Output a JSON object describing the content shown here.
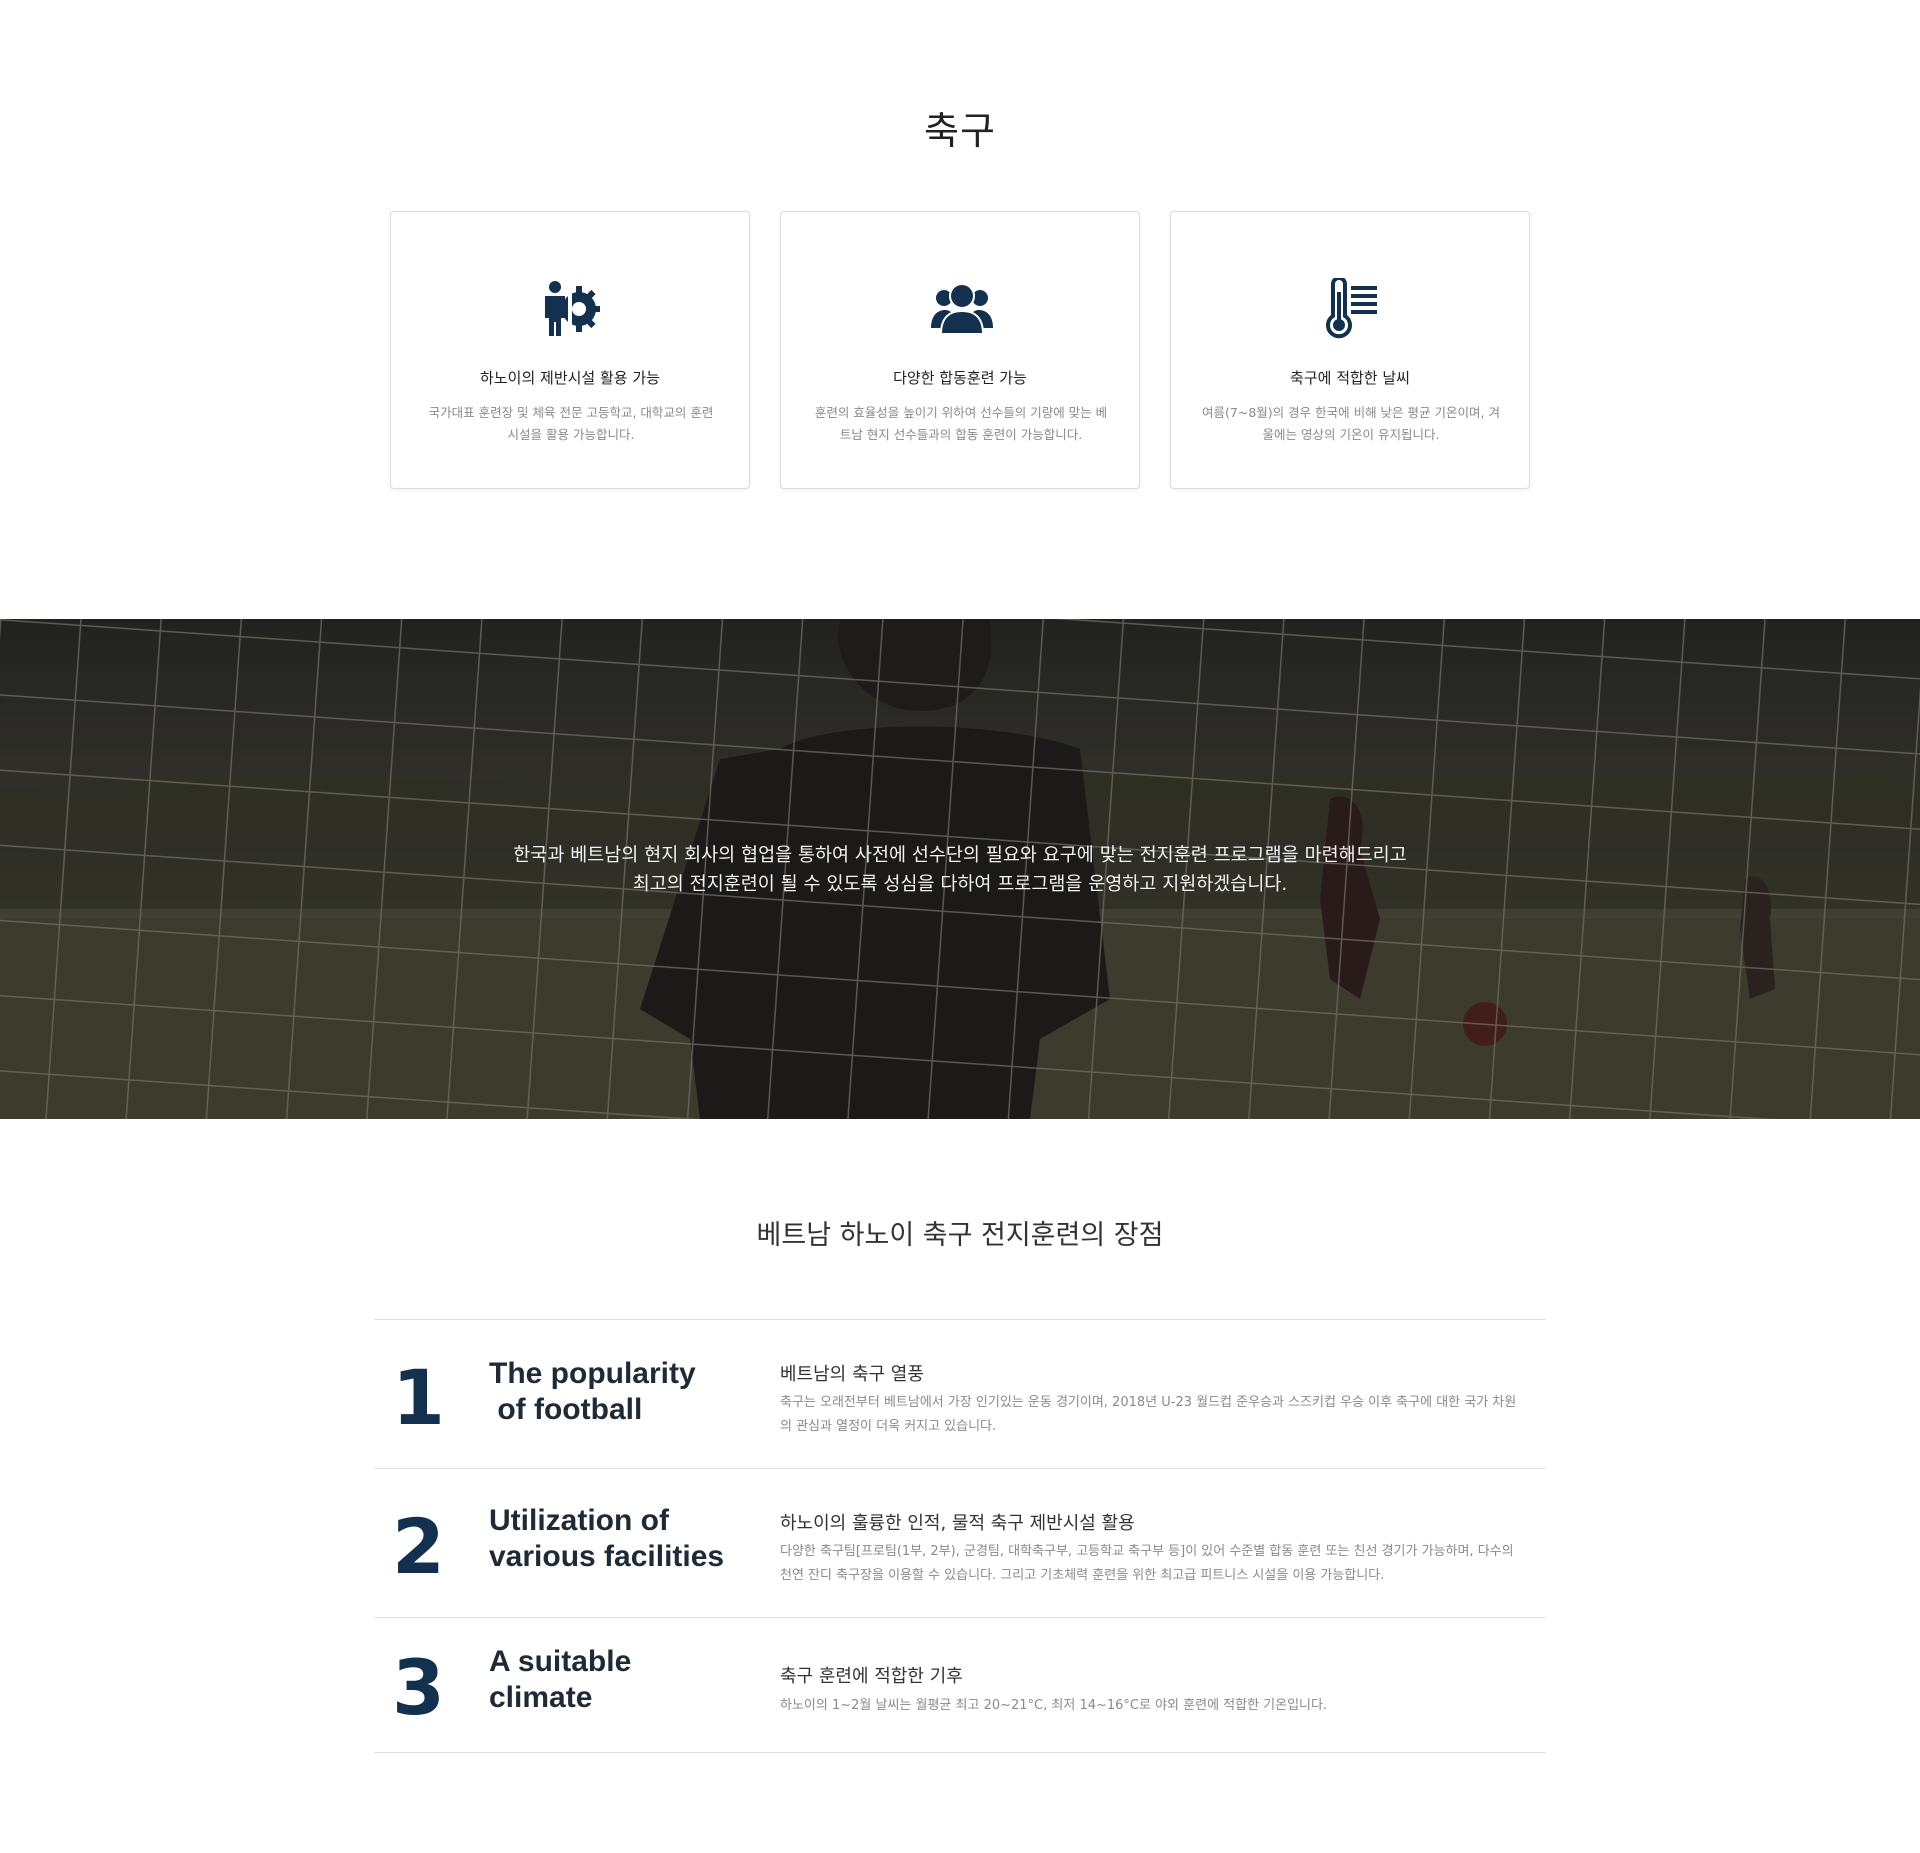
{
  "page": {
    "title": "축구"
  },
  "features": [
    {
      "icon": "person-gear-icon",
      "title": "하노이의 제반시설 활용 가능",
      "desc": "국가대표 훈련장 및 체육 전문 고등학교, 대학교의 훈련 시설을 활용 가능합니다."
    },
    {
      "icon": "group-people-icon",
      "title": "다양한 합동훈련 가능",
      "desc": "훈련의 효율성을 높이기 위하여 선수들의 기량에 맞는 베트남 현지 선수들과의 합동 훈련이 가능합니다."
    },
    {
      "icon": "thermometer-icon",
      "title": "축구에 적합한 날씨",
      "desc": "여름(7~8월)의 경우 한국에 비해 낮은 평균 기온이며, 겨울에는 영상의 기온이 유지됩니다."
    }
  ],
  "hero": {
    "line1": "한국과 베트남의 현지 회사의 협업을 통하여 사전에 선수단의 필요와 요구에 맞는 전지훈련 프로그램을 마련해드리고",
    "line2": "최고의 전지훈련이 될 수 있도록 성심을 다하여 프로그램을 운영하고 지원하겠습니다."
  },
  "advantages": {
    "title": "베트남 하노이 축구 전지훈련의 장점",
    "items": [
      {
        "num": "1",
        "en": "The popularity\n of football",
        "ko_title": "베트남의 축구 열풍",
        "ko_desc": "축구는 오래전부터 베트남에서 가장 인기있는 운동 경기이며, 2018년 U-23 월드컵 준우승과 스즈키컵 우승 이후 축구에 대한 국가 차원의 관심과 열정이 더욱 커지고 있습니다."
      },
      {
        "num": "2",
        "en": "Utilization of\nvarious facilities",
        "ko_title": "하노이의 훌륭한 인적, 물적 축구 제반시설 활용",
        "ko_desc": "다양한 축구팀[프로팀(1부, 2부), 군경팀, 대학축구부, 고등학교 축구부 등]이 있어 수준별 합동 훈련 또는 친선 경기가 가능하며, 다수의 천연 잔디 축구장을 이용할 수 있습니다. 그리고 기초체력 훈련을 위한 최고급 피트니스 시설을 이용 가능합니다."
      },
      {
        "num": "3",
        "en": "A suitable\nclimate",
        "ko_title": "축구 훈련에 적합한 기후",
        "ko_desc": "하노이의 1~2월 날씨는 월평균 최고 20~21°C, 최저 14~16°C로 야외 훈련에 적합한 기온입니다."
      }
    ]
  },
  "colors": {
    "icon": "#14304f",
    "number": "#14304f",
    "border": "#dcdcdc"
  }
}
